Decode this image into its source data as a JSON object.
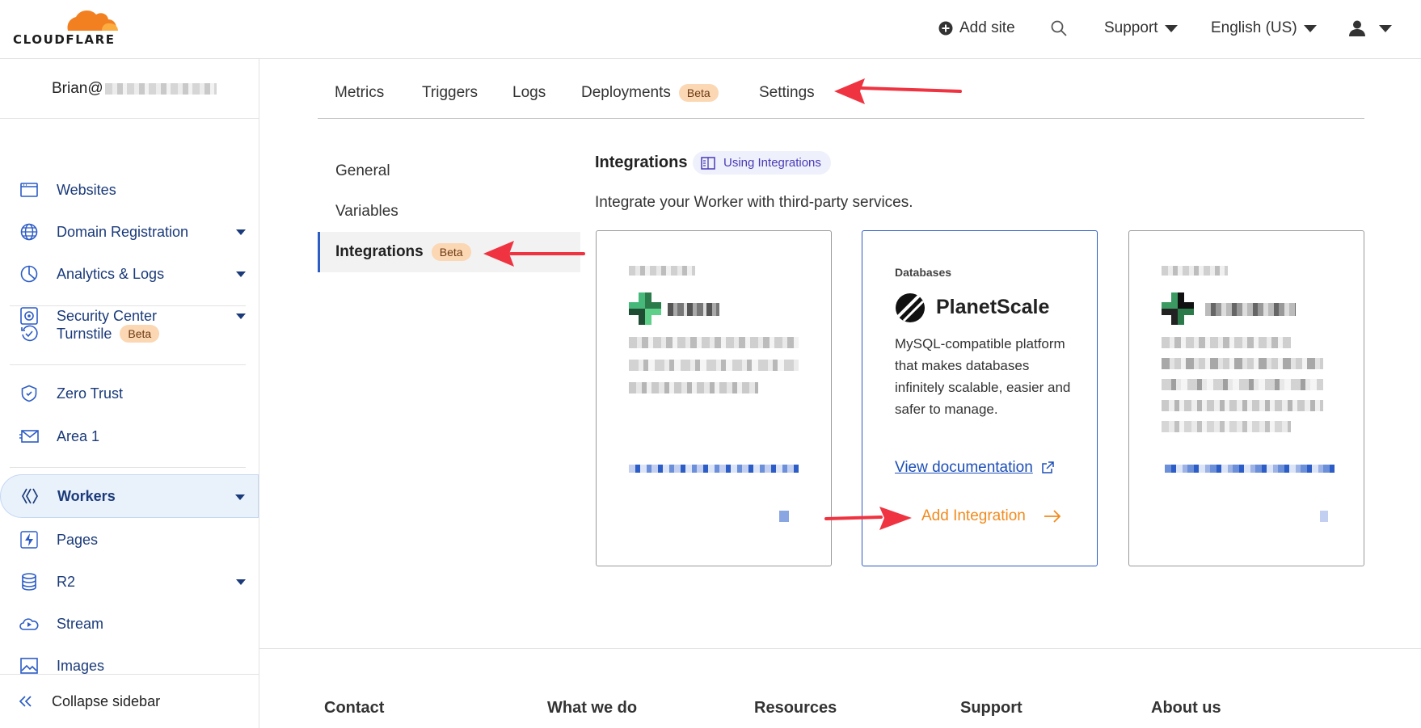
{
  "brand": {
    "name": "CLOUDFLARE",
    "accent": "#f38020"
  },
  "topbar": {
    "add_site": "Add site",
    "support": "Support",
    "language": "English (US)"
  },
  "sidebar": {
    "account": "Brian@",
    "items": [
      {
        "label": "Websites",
        "icon": "browser-window-icon"
      },
      {
        "label": "Domain Registration",
        "icon": "globe-icon"
      },
      {
        "label": "Analytics & Logs",
        "icon": "pie-chart-icon"
      },
      {
        "label": "Security Center",
        "icon": "security-gear-icon"
      },
      {
        "label": "Turnstile",
        "icon": "turnstile-icon",
        "badge": "Beta"
      },
      {
        "label": "Zero Trust",
        "icon": "shield-icon"
      },
      {
        "label": "Area 1",
        "icon": "envelope-icon"
      },
      {
        "label": "Workers",
        "icon": "workers-icon"
      },
      {
        "label": "Pages",
        "icon": "lightning-icon"
      },
      {
        "label": "R2",
        "icon": "database-icon"
      },
      {
        "label": "Stream",
        "icon": "cloud-play-icon"
      },
      {
        "label": "Images",
        "icon": "image-icon"
      }
    ],
    "collapse": "Collapse sidebar"
  },
  "tabs": {
    "metrics": "Metrics",
    "triggers": "Triggers",
    "logs": "Logs",
    "deployments": "Deployments",
    "deployments_badge": "Beta",
    "settings": "Settings"
  },
  "subnav": {
    "general": "General",
    "variables": "Variables",
    "integrations": "Integrations",
    "integrations_badge": "Beta"
  },
  "integrations": {
    "title": "Integrations",
    "link": "Using Integrations",
    "description": "Integrate your Worker with third-party services.",
    "card": {
      "category": "Databases",
      "name": "PlanetScale",
      "body": "MySQL-compatible platform that makes databases infinitely scalable, easier and safer to manage.",
      "view_doc": "View documentation",
      "add": "Add Integration"
    }
  },
  "footer": {
    "contact": "Contact",
    "what_we_do": "What we do",
    "resources": "Resources",
    "support": "Support",
    "about_us": "About us"
  }
}
